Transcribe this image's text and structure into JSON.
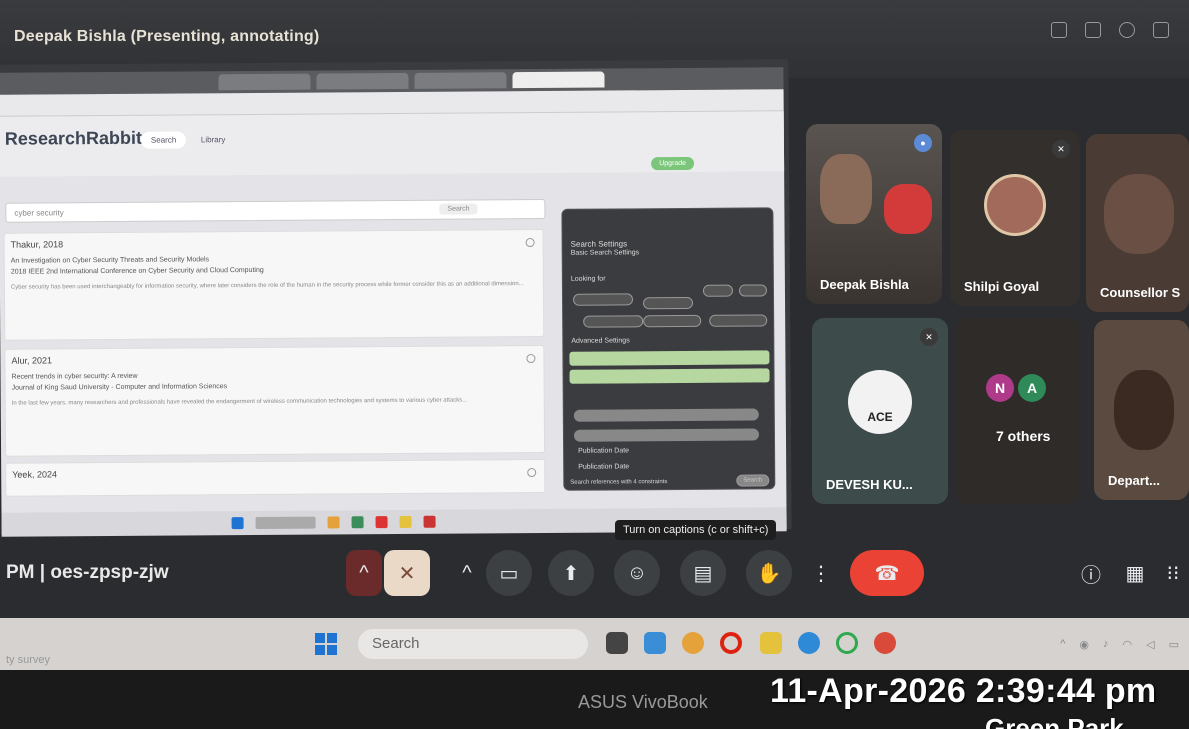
{
  "meeting": {
    "presenter_banner": "Deepak Bishla (Presenting, annotating)",
    "meeting_code": "PM  |  oes-zpsp-zjw",
    "caption_tooltip": "Turn on captions (c or shift+c)"
  },
  "shared_screen": {
    "app_name": "ResearchRabbit",
    "tabs": [
      "Search",
      "Library"
    ],
    "upgrade_label": "Upgrade",
    "search_query": "cyber security",
    "search_button": "Search",
    "results": [
      {
        "author_year": "Thakur, 2018",
        "title": "An Investigation on Cyber Security Threats and Security Models",
        "venue": "2018 IEEE 2nd International Conference on Cyber Security and Cloud Computing",
        "abstract": "Cyber security has been used interchangeably for information security, where later considers the role of the human in the security process while former consider this as an additional dimension..."
      },
      {
        "author_year": "Alur, 2021",
        "title": "Recent trends in cyber security: A review",
        "venue": "Journal of King Saud University - Computer and Information Sciences",
        "abstract": "In the last few years, many researchers and professionals have revealed the endangerment of wireless communication technologies and systems to various cyber attacks..."
      },
      {
        "author_year": "Yeek, 2024",
        "title": "",
        "venue": "",
        "abstract": ""
      }
    ],
    "panel": {
      "heading": "Search Settings",
      "subheading": "Basic Search Settings",
      "looking_for": "Looking for",
      "advanced": "Advanced Settings",
      "pub_date_1": "Publication Date",
      "pub_date_2": "Publication Date",
      "constraints": "Search references with 4 constraints",
      "search_btn": "Search"
    }
  },
  "participants": [
    {
      "name": "Deepak Bishla",
      "speaking": true
    },
    {
      "name": "Shilpi Goyal",
      "speaking": false
    },
    {
      "name": "Counsellor S",
      "speaking": false
    },
    {
      "name": "DEVESH KU...",
      "speaking": false
    },
    {
      "name": "7 others",
      "speaking": false
    },
    {
      "name": "Depart...",
      "speaking": false
    }
  ],
  "others_avatars": [
    "N",
    "A"
  ],
  "ace_logo_text": "ACE",
  "taskbar": {
    "search_placeholder": "Search",
    "bottom_left_text": "ty survey"
  },
  "device": {
    "brand": "ASUS VivoBook"
  },
  "timestamp_stamp": {
    "datetime": "11-Apr-2026 2:39:44 pm",
    "location": "Green Park"
  },
  "colors": {
    "end_call": "#ea4335",
    "mic_off": "#e9d9c6",
    "accent_green": "#7bc67a",
    "tile_bg": "#3c4043"
  }
}
